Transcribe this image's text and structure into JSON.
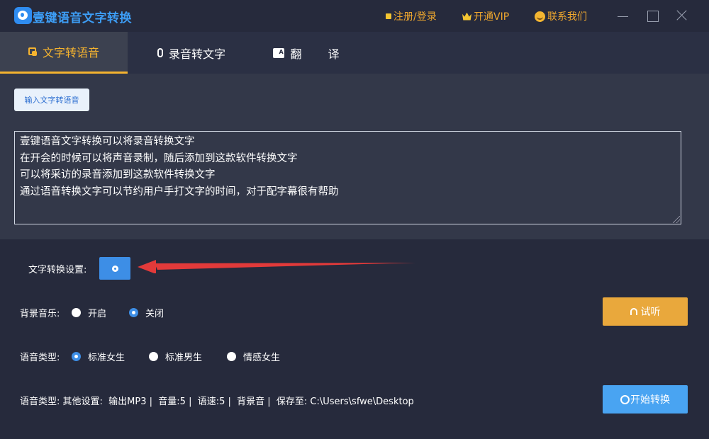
{
  "app": {
    "title": "壹键语音文字转换",
    "colors": {
      "accent": "#f5b32f",
      "primary": "#3d8ee6",
      "background": "#262a3c"
    }
  },
  "top_links": {
    "login": "注册/登录",
    "vip": "开通VIP",
    "contact": "联系我们"
  },
  "tabs": [
    {
      "label": "文字转语音",
      "icon": "text-to-speech-icon",
      "active": true
    },
    {
      "label": "录音转文字",
      "icon": "microphone-icon",
      "active": false
    },
    {
      "label": "翻 译",
      "icon": "translate-icon",
      "active": false
    }
  ],
  "input_panel": {
    "mode_button": "输入文字转语音",
    "text_lines": [
      "壹键语音文字转换可以将录音转换文字",
      "在开会的时候可以将声音录制，随后添加到这款软件转换文字",
      "可以将采访的录音添加到这款软件转换文字",
      "通过语音转换文字可以节约用户手打文字的时间，对于配字幕很有帮助"
    ]
  },
  "settings": {
    "conversion_label": "文字转换设置:",
    "bgm": {
      "label": "背景音乐:",
      "options": [
        "开启",
        "关闭"
      ],
      "selected": "关闭"
    },
    "voice": {
      "label": "语音类型:",
      "options": [
        "标准女生",
        "标准男生",
        "情感女生"
      ],
      "selected": "标准女生"
    },
    "other": {
      "row_label": "语音类型:",
      "text": "其他设置:  输出MP3 |  音量:5 |  语速:5 |  背景音 |  保存至: C:\\Users\\sfwe\\Desktop"
    }
  },
  "buttons": {
    "listen": "试听",
    "start": "开始转换"
  }
}
